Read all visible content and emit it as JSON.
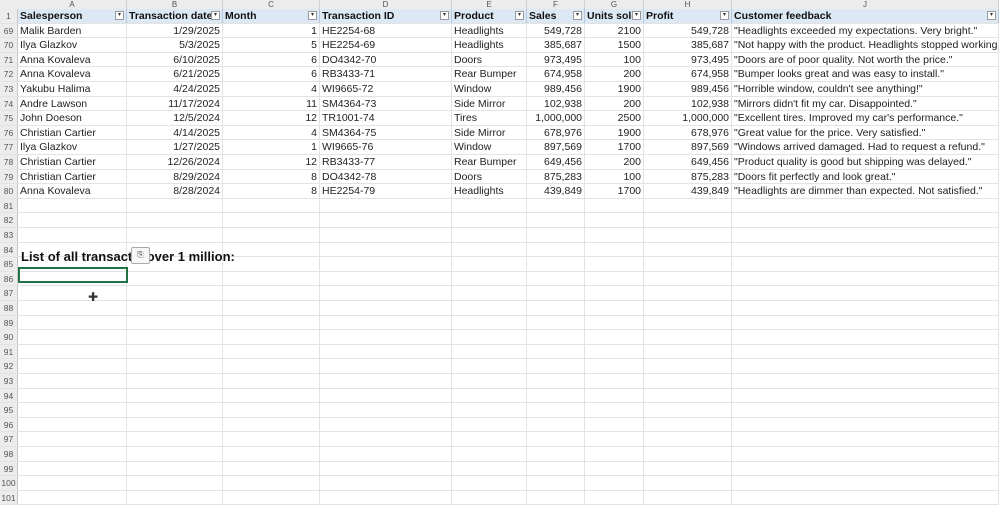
{
  "columns": [
    "A",
    "B",
    "C",
    "D",
    "E",
    "F",
    "G",
    "H",
    "J"
  ],
  "header": {
    "row_number": "1",
    "labels": [
      "Salesperson",
      "Transaction date",
      "Month",
      "Transaction ID",
      "Product",
      "Sales",
      "Units sold",
      "Profit",
      "Customer feedback"
    ]
  },
  "rows": [
    {
      "num": "69",
      "salesperson": "Malik Barden",
      "date": "1/29/2025",
      "month": "1",
      "id": "HE2254-68",
      "product": "Headlights",
      "sales": "549,728",
      "units": "2100",
      "profit": "549,728",
      "feedback": "\"Headlights exceeded my expectations. Very bright.\""
    },
    {
      "num": "70",
      "salesperson": "Ilya Glazkov",
      "date": "5/3/2025",
      "month": "5",
      "id": "HE2254-69",
      "product": "Headlights",
      "sales": "385,687",
      "units": "1500",
      "profit": "385,687",
      "feedback": "\"Not happy with the product. Headlights stopped working a"
    },
    {
      "num": "71",
      "salesperson": "Anna Kovaleva",
      "date": "6/10/2025",
      "month": "6",
      "id": "DO4342-70",
      "product": "Doors",
      "sales": "973,495",
      "units": "100",
      "profit": "973,495",
      "feedback": "\"Doors are of poor quality. Not worth the price.\""
    },
    {
      "num": "72",
      "salesperson": "Anna Kovaleva",
      "date": "6/21/2025",
      "month": "6",
      "id": "RB3433-71",
      "product": "Rear Bumper",
      "sales": "674,958",
      "units": "200",
      "profit": "674,958",
      "feedback": "\"Bumper looks great and was easy to install.\""
    },
    {
      "num": "73",
      "salesperson": "Yakubu Halima",
      "date": "4/24/2025",
      "month": "4",
      "id": "WI9665-72",
      "product": "Window",
      "sales": "989,456",
      "units": "1900",
      "profit": "989,456",
      "feedback": "\"Horrible window, couldn't see anything!\""
    },
    {
      "num": "74",
      "salesperson": "Andre Lawson",
      "date": "11/17/2024",
      "month": "11",
      "id": "SM4364-73",
      "product": "Side Mirror",
      "sales": "102,938",
      "units": "200",
      "profit": "102,938",
      "feedback": "\"Mirrors didn't fit my car. Disappointed.\""
    },
    {
      "num": "75",
      "salesperson": "John Doeson",
      "date": "12/5/2024",
      "month": "12",
      "id": "TR1001-74",
      "product": "Tires",
      "sales": "1,000,000",
      "units": "2500",
      "profit": "1,000,000",
      "feedback": "\"Excellent tires. Improved my car's performance.\""
    },
    {
      "num": "76",
      "salesperson": "Christian Cartier",
      "date": "4/14/2025",
      "month": "4",
      "id": "SM4364-75",
      "product": "Side Mirror",
      "sales": "678,976",
      "units": "1900",
      "profit": "678,976",
      "feedback": "\"Great value for the price. Very satisfied.\""
    },
    {
      "num": "77",
      "salesperson": "Ilya Glazkov",
      "date": "1/27/2025",
      "month": "1",
      "id": "WI9665-76",
      "product": "Window",
      "sales": "897,569",
      "units": "1700",
      "profit": "897,569",
      "feedback": "\"Windows arrived damaged. Had to request a refund.\""
    },
    {
      "num": "78",
      "salesperson": "Christian Cartier",
      "date": "12/26/2024",
      "month": "12",
      "id": "RB3433-77",
      "product": "Rear Bumper",
      "sales": "649,456",
      "units": "200",
      "profit": "649,456",
      "feedback": "\"Product quality is good but shipping was delayed.\""
    },
    {
      "num": "79",
      "salesperson": "Christian Cartier",
      "date": "8/29/2024",
      "month": "8",
      "id": "DO4342-78",
      "product": "Doors",
      "sales": "875,283",
      "units": "100",
      "profit": "875,283",
      "feedback": "\"Doors fit perfectly and look great.\""
    },
    {
      "num": "80",
      "salesperson": "Anna Kovaleva",
      "date": "8/28/2024",
      "month": "8",
      "id": "HE2254-79",
      "product": "Headlights",
      "sales": "439,849",
      "units": "1700",
      "profit": "439,849",
      "feedback": "\"Headlights are dimmer than expected. Not satisfied.\""
    }
  ],
  "empty_rows": [
    "81",
    "82",
    "83",
    "84",
    "85",
    "86",
    "87",
    "88",
    "89",
    "90",
    "91",
    "92",
    "93",
    "94",
    "95",
    "96",
    "97",
    "98",
    "99",
    "100",
    "101"
  ],
  "heading_text": "List of all transact    s over 1 million:",
  "colors": {
    "header_fill": "#dde8f5",
    "active_border": "#217346"
  }
}
